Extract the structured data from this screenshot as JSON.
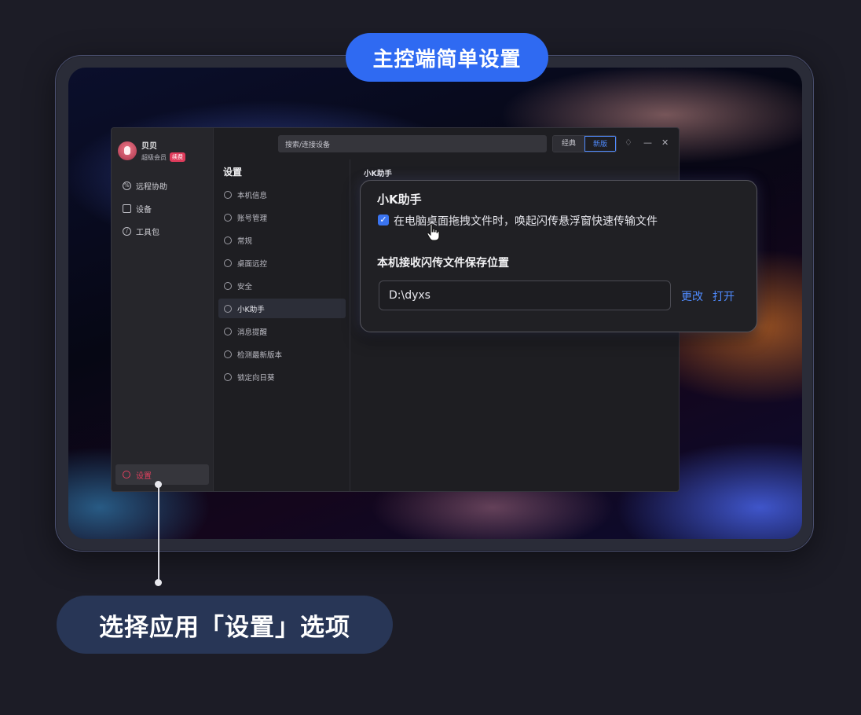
{
  "title_pill": "主控端简单设置",
  "caption": "选择应用「设置」选项",
  "app": {
    "user": {
      "name": "贝贝",
      "membership": "超级会员",
      "badge": "续费"
    },
    "nav": [
      {
        "label": "远程协助",
        "icon": "remote-assist-icon"
      },
      {
        "label": "设备",
        "icon": "monitor-icon"
      },
      {
        "label": "工具包",
        "icon": "compass-icon"
      }
    ],
    "settings_nav": {
      "label": "设置",
      "icon": "gear-icon"
    },
    "search_placeholder": "搜索/连接设备",
    "mode_switch": [
      "经典",
      "新版"
    ],
    "settings_list": {
      "title": "设置",
      "items": [
        {
          "label": "本机信息",
          "icon": "info-icon"
        },
        {
          "label": "账号管理",
          "icon": "user-icon"
        },
        {
          "label": "常规",
          "icon": "cube-icon"
        },
        {
          "label": "桌面远控",
          "icon": "remote-icon"
        },
        {
          "label": "安全",
          "icon": "shield-icon"
        },
        {
          "label": "小K助手",
          "icon": "robot-icon"
        },
        {
          "label": "消息提醒",
          "icon": "message-icon"
        },
        {
          "label": "检测最新版本",
          "icon": "refresh-icon"
        },
        {
          "label": "锁定向日葵",
          "icon": "lock-icon"
        }
      ]
    },
    "content_title": "小K助手"
  },
  "card": {
    "title": "小K助手",
    "checkbox_label": "在电脑桌面拖拽文件时，唤起闪传悬浮窗快速传输文件",
    "checkbox_checked": true,
    "save_location_label": "本机接收闪传文件保存位置",
    "path_value": "D:\\dyxs",
    "change_label": "更改",
    "open_label": "打开"
  },
  "colors": {
    "accent": "#2f6af2",
    "link": "#4f8bff",
    "danger": "#e0405e",
    "caption_bg": "#283656"
  }
}
